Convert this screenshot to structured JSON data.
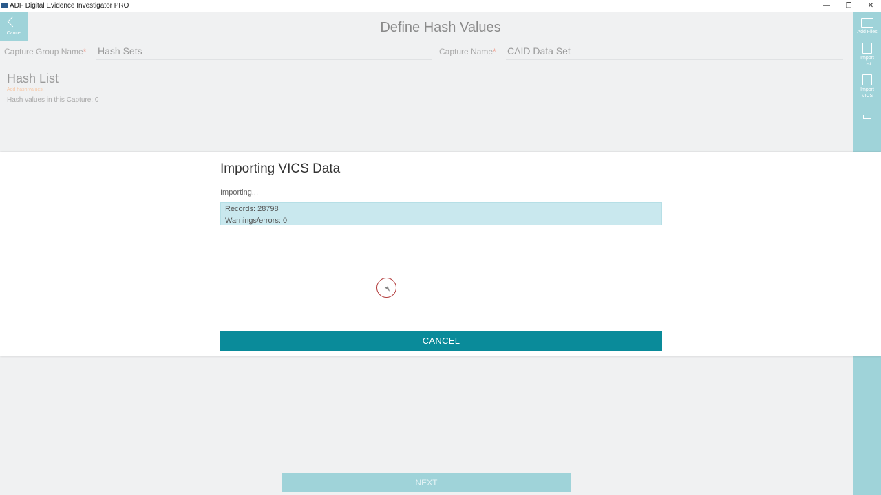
{
  "window": {
    "title": "ADF Digital Evidence Investigator PRO",
    "controls": {
      "minimize": "—",
      "maximize": "❐",
      "close": "✕"
    }
  },
  "back_button": {
    "label": "Cancel",
    "icon": "chevron-left-icon"
  },
  "page": {
    "title": "Define Hash Values",
    "capture_group": {
      "label": "Capture Group Name",
      "required_mark": "*",
      "value": "Hash Sets"
    },
    "capture_name": {
      "label": "Capture Name",
      "required_mark": "*",
      "value": "CAID Data Set"
    },
    "hash_list": {
      "title": "Hash List",
      "add_hint": "Add hash values.",
      "count_text": "Hash values in this Capture: 0"
    },
    "next_button": {
      "label": "NEXT"
    }
  },
  "right_rail": {
    "items": [
      {
        "label": "Add Files",
        "icon": "folder-add-icon"
      },
      {
        "label": "Import List",
        "icon": "document-list-icon"
      },
      {
        "label": "Import VICS",
        "icon": "document-import-icon"
      }
    ]
  },
  "modal": {
    "title": "Importing VICS Data",
    "status": "Importing...",
    "records": "Records: 28798",
    "warnings": "Warnings/errors: 0",
    "cancel_label": "CANCEL"
  },
  "colors": {
    "accent": "#0a8b9a",
    "accent_light": "#9fd3d9",
    "progress_bg": "#c9e8ee",
    "required": "#ef9a8a"
  }
}
